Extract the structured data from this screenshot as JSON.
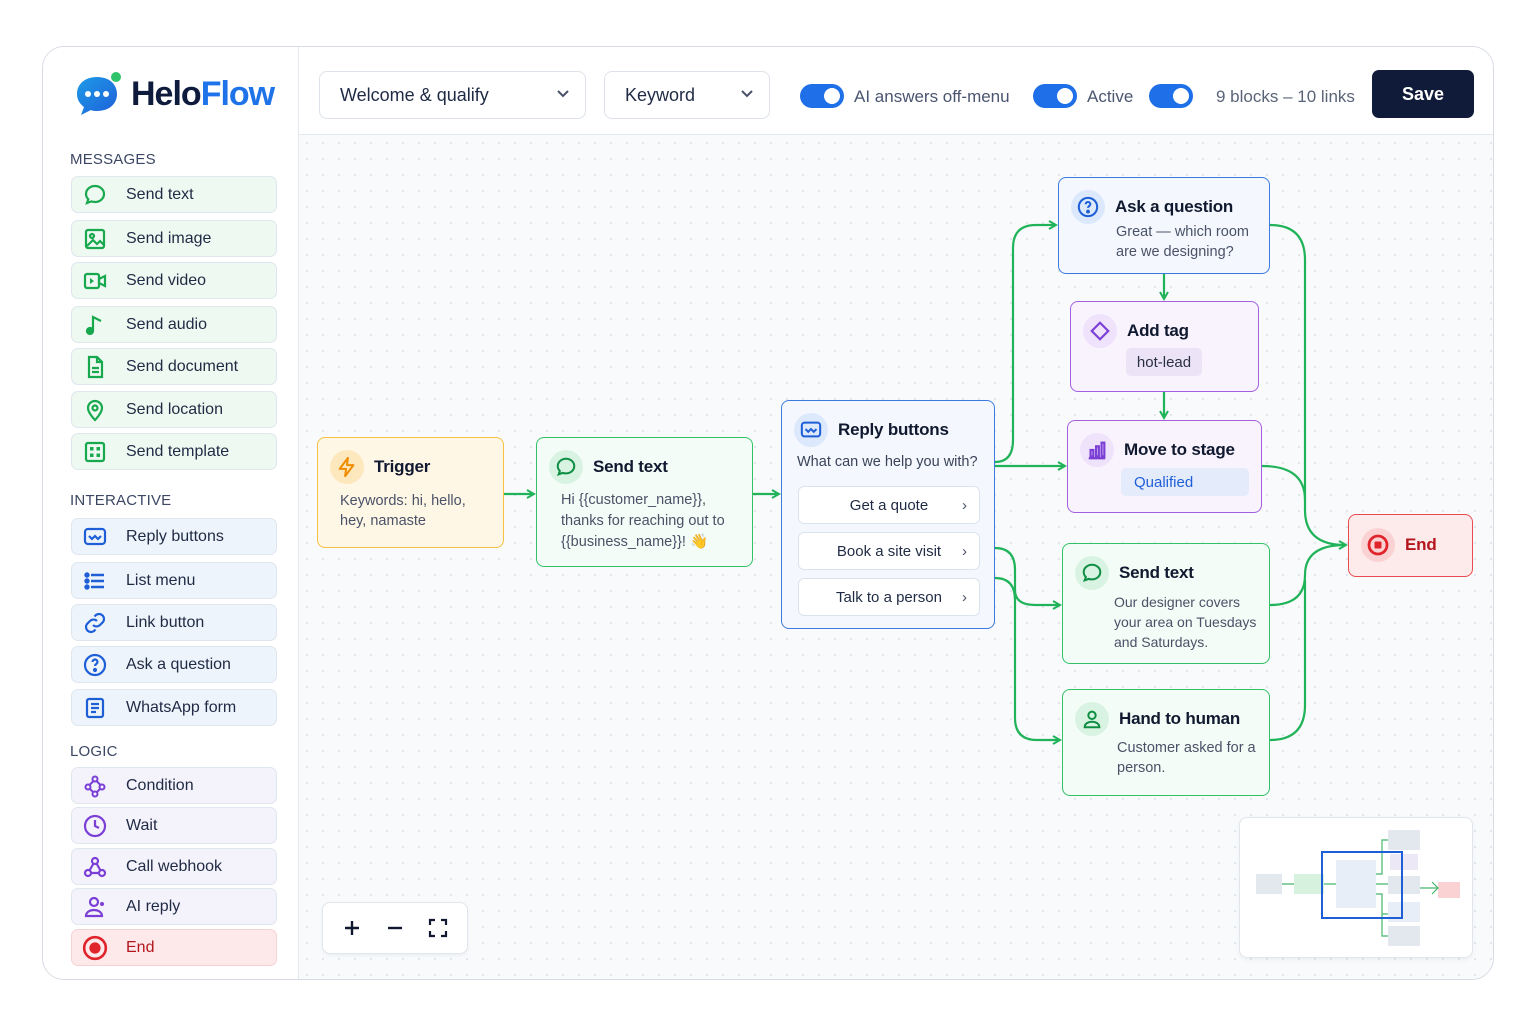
{
  "app": {
    "brand_part1": "Helo",
    "brand_part2": "Flow"
  },
  "sidebar": {
    "sections": [
      {
        "title": "MESSAGES",
        "items": [
          {
            "label": "Send text",
            "icon": "chat-bubble-icon"
          },
          {
            "label": "Send image",
            "icon": "image-icon"
          },
          {
            "label": "Send video",
            "icon": "video-icon"
          },
          {
            "label": "Send audio",
            "icon": "music-note-icon"
          },
          {
            "label": "Send document",
            "icon": "document-icon"
          },
          {
            "label": "Send location",
            "icon": "location-pin-icon"
          },
          {
            "label": "Send template",
            "icon": "template-grid-icon"
          }
        ]
      },
      {
        "title": "INTERACTIVE",
        "items": [
          {
            "label": "Reply buttons",
            "icon": "reply-buttons-icon"
          },
          {
            "label": "List menu",
            "icon": "list-icon"
          },
          {
            "label": "Link button",
            "icon": "link-icon"
          },
          {
            "label": "Ask a question",
            "icon": "question-icon"
          },
          {
            "label": "WhatsApp form",
            "icon": "form-icon"
          }
        ]
      },
      {
        "title": "LOGIC",
        "items": [
          {
            "label": "Condition",
            "icon": "branch-icon"
          },
          {
            "label": "Wait",
            "icon": "clock-icon"
          },
          {
            "label": "Call webhook",
            "icon": "webhook-icon"
          },
          {
            "label": "AI reply",
            "icon": "ai-agent-icon"
          },
          {
            "label": "End",
            "icon": "end-target-icon"
          }
        ]
      }
    ]
  },
  "toolbar": {
    "flow_select": "Welcome & qualify",
    "trigger_select": "Keyword",
    "ai_toggle_label": "AI answers off-menu",
    "ai_toggle_on": true,
    "active_toggle_label": "Active",
    "active_toggle_on": true,
    "third_toggle_on": true,
    "counts": "9 blocks – 10 links",
    "save_label": "Save"
  },
  "nodes": {
    "trigger": {
      "title": "Trigger",
      "body": "Keywords: hi, hello, hey, namaste"
    },
    "send_text_1": {
      "title": "Send text",
      "body": "Hi {{customer_name}}, thanks for reaching out to {{business_name}}! 👋"
    },
    "reply_buttons": {
      "title": "Reply buttons",
      "prompt": "What can we help you with?",
      "options": [
        "Get a quote",
        "Book a site visit",
        "Talk to a person"
      ]
    },
    "ask_question": {
      "title": "Ask a question",
      "body": "Great — which room are we designing?"
    },
    "add_tag": {
      "title": "Add tag",
      "tag": "hot-lead"
    },
    "move_stage": {
      "title": "Move to stage",
      "stage": "Qualified"
    },
    "send_text_2": {
      "title": "Send text",
      "body": "Our designer covers your area on Tuesdays and Saturdays."
    },
    "hand_human": {
      "title": "Hand to human",
      "body": "Customer asked for a person."
    },
    "end": {
      "title": "End"
    }
  },
  "colors": {
    "edge": "#21b35a",
    "accent": "#1e6fe8",
    "save_bg": "#0f1b38"
  }
}
